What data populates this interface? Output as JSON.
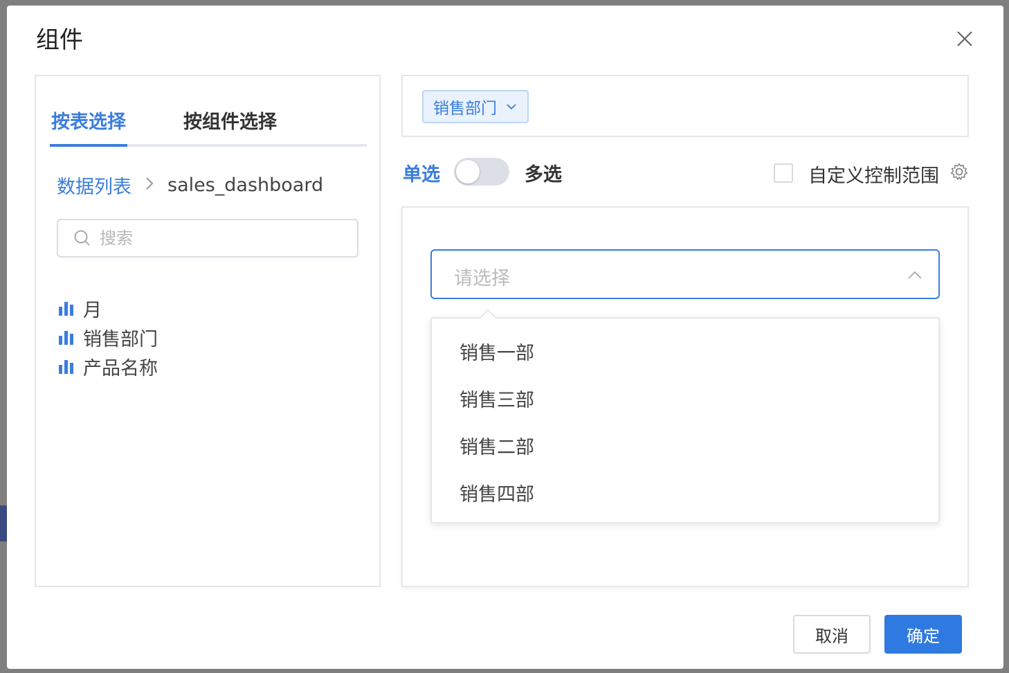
{
  "dialog": {
    "title": "组件",
    "close_icon": "close-icon"
  },
  "left": {
    "tabs": [
      {
        "label": "按表选择",
        "active": true
      },
      {
        "label": "按组件选择",
        "active": false
      }
    ],
    "breadcrumb": {
      "root": "数据列表",
      "separator": ">",
      "current": "sales_dashboard"
    },
    "search": {
      "placeholder": "搜索",
      "value": ""
    },
    "fields": [
      {
        "label": "月",
        "icon": "bar-chart-icon"
      },
      {
        "label": "销售部门",
        "icon": "bar-chart-icon"
      },
      {
        "label": "产品名称",
        "icon": "bar-chart-icon"
      }
    ]
  },
  "right": {
    "selected_tag": {
      "label": "销售部门"
    },
    "mode": {
      "single": "单选",
      "multi": "多选",
      "multi_enabled": false
    },
    "custom_range": {
      "label": "自定义控制范围",
      "checked": false
    },
    "preview": {
      "select_placeholder": "请选择",
      "options": [
        "销售一部",
        "销售三部",
        "销售二部",
        "销售四部"
      ]
    }
  },
  "footer": {
    "cancel": "取消",
    "confirm": "确定"
  },
  "colors": {
    "accent": "#3b7ddd",
    "primary_button": "#2f7ae0"
  }
}
